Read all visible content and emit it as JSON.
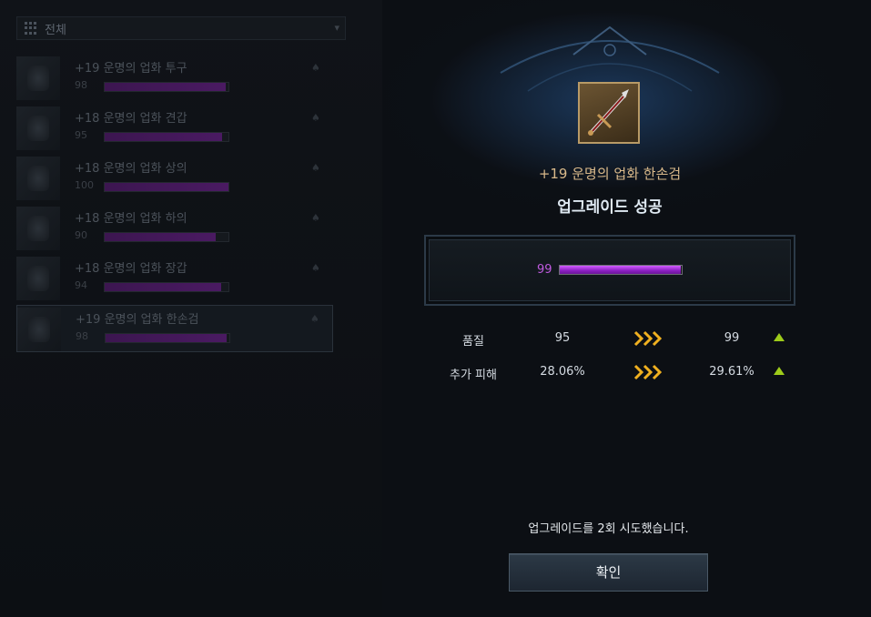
{
  "list": {
    "filter_label": "전체",
    "items": [
      {
        "name": "+19 운명의 업화 투구",
        "quality": "98",
        "fill": 0.98
      },
      {
        "name": "+18 운명의 업화 견갑",
        "quality": "95",
        "fill": 0.95
      },
      {
        "name": "+18 운명의 업화 상의",
        "quality": "100",
        "fill": 1.0
      },
      {
        "name": "+18 운명의 업화 하의",
        "quality": "90",
        "fill": 0.9
      },
      {
        "name": "+18 운명의 업화 장갑",
        "quality": "94",
        "fill": 0.94
      },
      {
        "name": "+19 운명의 업화 한손검",
        "quality": "98",
        "fill": 0.98
      }
    ]
  },
  "dialog": {
    "item_name": "+19 운명의 업화 한손검",
    "result": "업그레이드 성공",
    "quality_value": "99",
    "quality_fill": 0.99,
    "stats": [
      {
        "label": "품질",
        "before": "95",
        "after": "99"
      },
      {
        "label": "추가 피해",
        "before": "28.06%",
        "after": "29.61%"
      }
    ],
    "attempt_message": "업그레이드를 2회 시도했습니다.",
    "confirm_label": "확인"
  },
  "colors": {
    "quality_purple": "#c05ae0",
    "arrow_gold": "#f0b020",
    "up_green": "#9ecb1a",
    "title_gold": "#d9b98a"
  }
}
